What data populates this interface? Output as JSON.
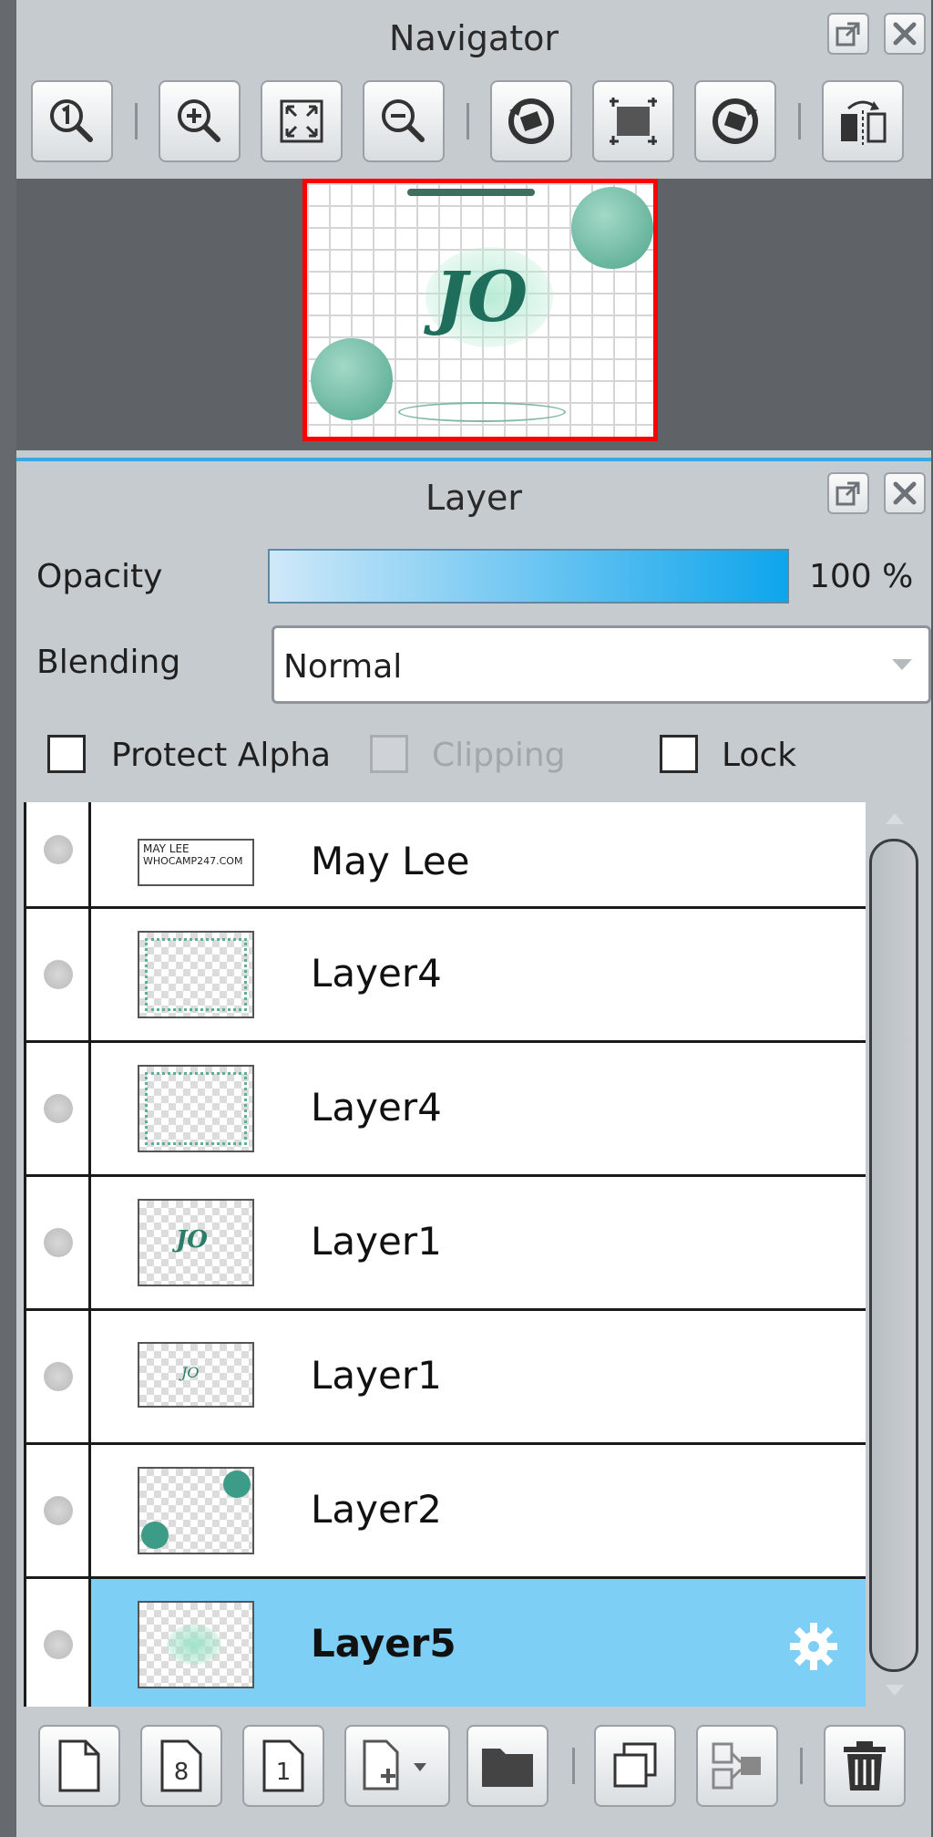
{
  "navigator": {
    "title": "Navigator",
    "toolbar": [
      {
        "name": "zoom-actual-size-button",
        "icon": "zoom-1-icon"
      },
      {
        "name": "zoom-in-button",
        "icon": "zoom-in-icon"
      },
      {
        "name": "fit-to-window-button",
        "icon": "fit-icon"
      },
      {
        "name": "zoom-out-button",
        "icon": "zoom-out-icon"
      },
      {
        "name": "rotate-left-button",
        "icon": "rotate-left-icon"
      },
      {
        "name": "reset-view-button",
        "icon": "reset-view-icon"
      },
      {
        "name": "rotate-right-button",
        "icon": "rotate-right-icon"
      },
      {
        "name": "flip-horizontal-button",
        "icon": "flip-horizontal-icon"
      }
    ],
    "preview_text": "JO"
  },
  "layer_panel": {
    "title": "Layer",
    "opacity_label": "Opacity",
    "opacity_value": "100 %",
    "opacity_fraction": 1.0,
    "blending_label": "Blending",
    "blending_value": "Normal",
    "protect_alpha_label": "Protect Alpha",
    "clipping_label": "Clipping",
    "lock_label": "Lock",
    "layers": [
      {
        "name": "May Lee",
        "thumb": "text",
        "selected": false
      },
      {
        "name": "Layer4",
        "thumb": "frame",
        "selected": false
      },
      {
        "name": "Layer4",
        "thumb": "frame",
        "selected": false
      },
      {
        "name": "Layer1",
        "thumb": "jo-large",
        "selected": false
      },
      {
        "name": "Layer1",
        "thumb": "jo-small",
        "selected": false
      },
      {
        "name": "Layer2",
        "thumb": "bubbles",
        "selected": false
      },
      {
        "name": "Layer5",
        "thumb": "blob",
        "selected": true
      }
    ],
    "thumb_text_line1": "MAY LEE",
    "thumb_text_line2": "WHOCAMP247.COM",
    "thumb_jo_text": "JO"
  },
  "colors": {
    "selection": "#7dcff5",
    "accent_teal": "#3d9c87",
    "opacity_bar_start": "#cfe8f8",
    "opacity_bar_end": "#0ea5ec",
    "highlight_border": "#ff0000"
  }
}
